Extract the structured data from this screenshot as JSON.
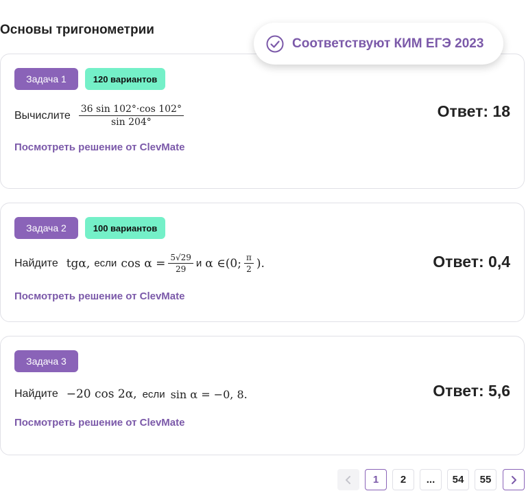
{
  "section_title": "Основы тригонометрии",
  "kim_badge": {
    "label": "Соответствуют КИМ ЕГЭ 2023",
    "icon": "check-circle-icon"
  },
  "tasks": [
    {
      "label": "Задача 1",
      "variants": "120 вариантов",
      "lead": "Вычислите",
      "formula": {
        "numerator": "36 sin 102°·cos 102°",
        "denominator": "sin 204°"
      },
      "answer": "Ответ: 18",
      "solution_link": "Посмотреть решение от ClevMate"
    },
    {
      "label": "Задача 2",
      "variants": "100 вариантов",
      "lead": "Найдите",
      "expr1": "tgα,",
      "if_word": "если",
      "cos_part": "cos α =",
      "frac_num": "5√29",
      "frac_den": "29",
      "and_word": "и",
      "interval_prefix": "α ∈(0;",
      "pi_num": "π",
      "pi_den": "2",
      "interval_suffix": ").",
      "answer": "Ответ: 0,4",
      "solution_link": "Посмотреть решение от ClevMate"
    },
    {
      "label": "Задача 3",
      "lead": "Найдите",
      "expr1": "−20 cos 2α,",
      "if_word": "если",
      "expr2": "sin α = −0, 8.",
      "answer": "Ответ: 5,6",
      "solution_link": "Посмотреть решение от ClevMate"
    }
  ],
  "pagination": {
    "prev_icon": "chevron-left-icon",
    "pages": [
      "1",
      "2",
      "...",
      "54",
      "55"
    ],
    "current": "1",
    "next_icon": "chevron-right-icon"
  },
  "colors": {
    "accent": "#7b59a9",
    "tag_bg": "#8a63b8",
    "variants_bg": "#74f0c8",
    "border": "#e0e0e6"
  }
}
